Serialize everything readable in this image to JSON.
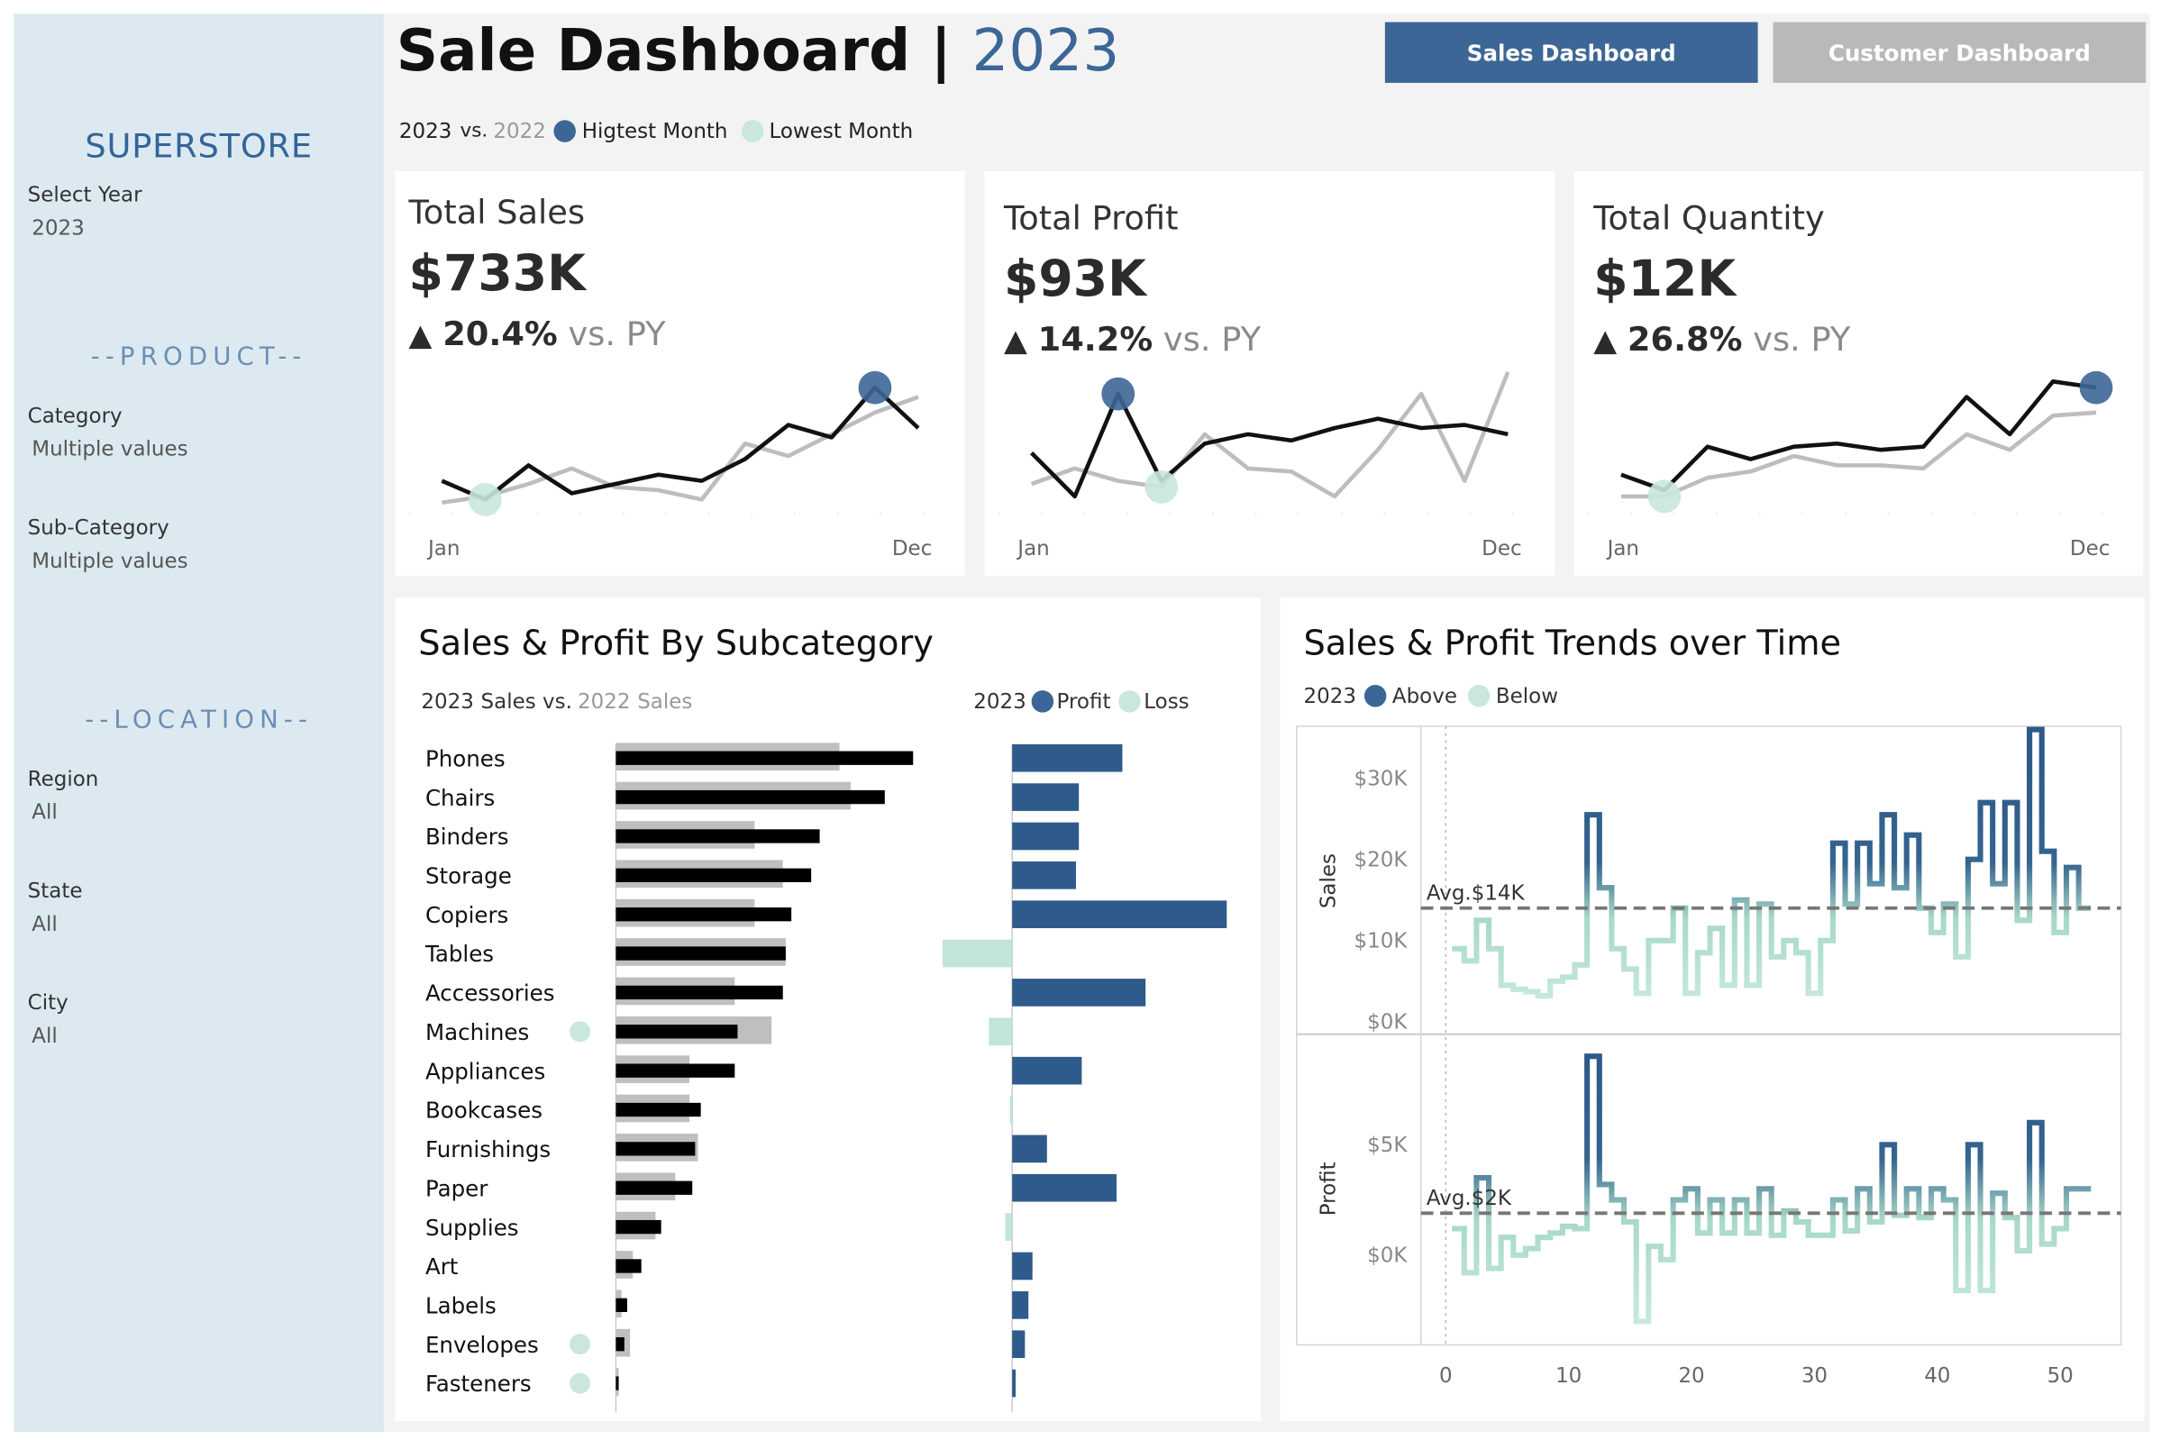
{
  "header": {
    "title": "Sale Dashboard |",
    "year": "2023",
    "nav": {
      "sales_label": "Sales Dashboard",
      "customer_label": "Customer Dashboard"
    },
    "legend": {
      "current": "2023",
      "vs": "vs.",
      "previous": "2022",
      "highest": "Higtest Month",
      "lowest": "Lowest Month"
    }
  },
  "sidebar": {
    "brand": "SUPERSTORE",
    "select_year_label": "Select Year",
    "select_year_value": "2023",
    "product_title": "--PRODUCT--",
    "category_label": "Category",
    "category_value": "Multiple values",
    "subcategory_label": "Sub-Category",
    "subcategory_value": "Multiple values",
    "location_title": "--LOCATION--",
    "region_label": "Region",
    "region_value": "All",
    "state_label": "State",
    "state_value": "All",
    "city_label": "City",
    "city_value": "All"
  },
  "kpis": [
    {
      "title": "Total Sales",
      "value": "$733K",
      "change": "20.4%",
      "vs": "vs. PY",
      "start_label": "Jan",
      "end_label": "Dec",
      "current": [
        0.35,
        0.05,
        0.6,
        0.15,
        0.3,
        0.45,
        0.35,
        0.7,
        1.25,
        1.05,
        1.85,
        1.2
      ],
      "previous": [
        0.0,
        0.1,
        0.3,
        0.55,
        0.25,
        0.2,
        0.05,
        0.95,
        0.75,
        1.1,
        1.45,
        1.7
      ],
      "high_month": 11,
      "low_month": 2
    },
    {
      "title": "Total Profit",
      "value": "$93K",
      "change": "14.2%",
      "vs": "vs. PY",
      "start_label": "Jan",
      "end_label": "Dec",
      "current": [
        0.8,
        0.1,
        1.75,
        0.35,
        0.95,
        1.1,
        1.0,
        1.2,
        1.35,
        1.2,
        1.25,
        1.1
      ],
      "previous": [
        0.3,
        0.55,
        0.35,
        0.25,
        1.1,
        0.55,
        0.5,
        0.1,
        0.85,
        1.75,
        0.35,
        2.1
      ],
      "high_month": 3,
      "low_month": 4
    },
    {
      "title": "Total Quantity",
      "value": "$12K",
      "change": "26.8%",
      "vs": "vs. PY",
      "start_label": "Jan",
      "end_label": "Dec",
      "current": [
        0.45,
        0.2,
        0.9,
        0.7,
        0.9,
        0.95,
        0.85,
        0.9,
        1.7,
        1.1,
        1.95,
        1.85
      ],
      "previous": [
        0.1,
        0.1,
        0.4,
        0.5,
        0.75,
        0.6,
        0.6,
        0.55,
        1.1,
        0.85,
        1.4,
        1.45
      ],
      "high_month": 12,
      "low_month": 2
    }
  ],
  "subcategory": {
    "title": "Sales & Profit By Subcategory",
    "legend_current": "2023",
    "legend_sales": "Sales vs.",
    "legend_previous": "2022",
    "legend_previous_sales": "Sales",
    "legend_profit_year": "2023",
    "legend_profit": "Profit",
    "legend_loss": "Loss",
    "items": [
      {
        "name": "Phones",
        "sales": 105,
        "prev": 79,
        "profit": 19,
        "loss_marker": false
      },
      {
        "name": "Chairs",
        "sales": 95,
        "prev": 83,
        "profit": 11.5,
        "loss_marker": false
      },
      {
        "name": "Binders",
        "sales": 72,
        "prev": 49,
        "profit": 11.5,
        "loss_marker": false
      },
      {
        "name": "Storage",
        "sales": 69,
        "prev": 59,
        "profit": 11,
        "loss_marker": false
      },
      {
        "name": "Copiers",
        "sales": 62,
        "prev": 49,
        "profit": 37,
        "loss_marker": false
      },
      {
        "name": "Tables",
        "sales": 60,
        "prev": 60,
        "profit": -12,
        "loss_marker": false
      },
      {
        "name": "Accessories",
        "sales": 59,
        "prev": 42,
        "profit": 23,
        "loss_marker": false
      },
      {
        "name": "Machines",
        "sales": 43,
        "prev": 55,
        "profit": -4,
        "loss_marker": true
      },
      {
        "name": "Appliances",
        "sales": 42,
        "prev": 26,
        "profit": 12,
        "loss_marker": false
      },
      {
        "name": "Bookcases",
        "sales": 30,
        "prev": 26,
        "profit": -0.4,
        "loss_marker": false
      },
      {
        "name": "Furnishings",
        "sales": 28,
        "prev": 29,
        "profit": 6,
        "loss_marker": false
      },
      {
        "name": "Paper",
        "sales": 27,
        "prev": 21,
        "profit": 18,
        "loss_marker": false
      },
      {
        "name": "Supplies",
        "sales": 16,
        "prev": 14,
        "profit": -1.2,
        "loss_marker": false
      },
      {
        "name": "Art",
        "sales": 9,
        "prev": 6,
        "profit": 3.5,
        "loss_marker": false
      },
      {
        "name": "Labels",
        "sales": 4,
        "prev": 2,
        "profit": 2.8,
        "loss_marker": false
      },
      {
        "name": "Envelopes",
        "sales": 3,
        "prev": 5,
        "profit": 2.2,
        "loss_marker": true
      },
      {
        "name": "Fasteners",
        "sales": 1,
        "prev": 1,
        "profit": 0.6,
        "loss_marker": true
      }
    ]
  },
  "trends": {
    "title": "Sales & Profit Trends over Time",
    "legend_year": "2023",
    "legend_above": "Above",
    "legend_below": "Below",
    "sales_axis_label": "Sales",
    "profit_axis_label": "Profit",
    "sales_avg_label": "Avg.$14K",
    "profit_avg_label": "Avg.$2K",
    "sales_ticks": [
      "$0K",
      "$10K",
      "$20K",
      "$30K"
    ],
    "profit_ticks": [
      "$0K",
      "$5K"
    ],
    "x_ticks": [
      "0",
      "10",
      "20",
      "30",
      "40",
      "50"
    ]
  },
  "chart_data": [
    {
      "type": "line",
      "title": "Sales & Profit Trends over Time",
      "ylabel": "Sales",
      "ylim": [
        0,
        37000
      ],
      "x": [
        1,
        2,
        3,
        4,
        5,
        6,
        7,
        8,
        9,
        10,
        11,
        12,
        13,
        14,
        15,
        16,
        17,
        18,
        19,
        20,
        21,
        22,
        23,
        24,
        25,
        26,
        27,
        28,
        29,
        30,
        31,
        32,
        33,
        34,
        35,
        36,
        37,
        38,
        39,
        40,
        41,
        42,
        43,
        44,
        45,
        46,
        47,
        48,
        49,
        50,
        51,
        52
      ],
      "series": [
        {
          "name": "Sales",
          "values": [
            9000,
            7500,
            12500,
            9000,
            4500,
            4000,
            3700,
            3200,
            5000,
            5500,
            7000,
            25500,
            16500,
            9000,
            6500,
            3500,
            10000,
            10000,
            14000,
            3500,
            8500,
            11500,
            4500,
            15000,
            4500,
            14500,
            8000,
            10000,
            8500,
            3500,
            10000,
            22000,
            14500,
            22000,
            17000,
            25500,
            16500,
            23000,
            14000,
            11000,
            14500,
            8000,
            20000,
            27000,
            17000,
            27000,
            12500,
            36000,
            21000,
            11000,
            19000,
            14000
          ]
        }
      ],
      "avg": 14000,
      "grid": false
    },
    {
      "type": "line",
      "ylabel": "Profit",
      "ylim": [
        -3500,
        9500
      ],
      "x": [
        1,
        2,
        3,
        4,
        5,
        6,
        7,
        8,
        9,
        10,
        11,
        12,
        13,
        14,
        15,
        16,
        17,
        18,
        19,
        20,
        21,
        22,
        23,
        24,
        25,
        26,
        27,
        28,
        29,
        30,
        31,
        32,
        33,
        34,
        35,
        36,
        37,
        38,
        39,
        40,
        41,
        42,
        43,
        44,
        45,
        46,
        47,
        48,
        49,
        50,
        51,
        52
      ],
      "series": [
        {
          "name": "Profit",
          "values": [
            1200,
            -800,
            3500,
            -600,
            800,
            0,
            300,
            800,
            1000,
            1300,
            1200,
            9000,
            3200,
            2500,
            1500,
            -3000,
            400,
            -200,
            2500,
            3000,
            1000,
            2500,
            1000,
            2500,
            1000,
            3000,
            900,
            2000,
            1500,
            900,
            900,
            2500,
            1100,
            3000,
            1500,
            5000,
            1800,
            3000,
            1700,
            3000,
            2500,
            -1600,
            5000,
            -1600,
            2800,
            1700,
            200,
            6000,
            500,
            1200,
            3000,
            3000
          ]
        }
      ],
      "avg": 1900,
      "grid": false
    }
  ]
}
